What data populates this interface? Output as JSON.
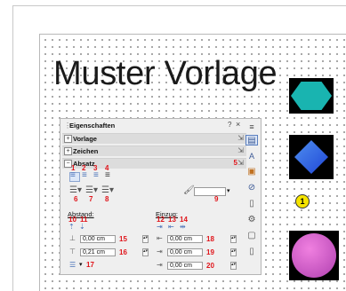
{
  "slide": {
    "title": "Muster Vorlage",
    "callout_number": "1"
  },
  "panel": {
    "title": "Eigenschaften",
    "help": "?",
    "close": "×",
    "sections": [
      {
        "label": "Vorlage"
      },
      {
        "label": "Zeichen"
      },
      {
        "label": "Absatz",
        "marker": "5"
      }
    ],
    "markers": [
      "1",
      "2",
      "3",
      "4",
      "6",
      "7",
      "8",
      "9",
      "10",
      "11",
      "12",
      "13",
      "14",
      "15",
      "16",
      "17",
      "18",
      "19",
      "20"
    ],
    "abstand_label": "Abstand:",
    "einzug_label": "Einzug:",
    "fields": {
      "space_above": "0,00 cm",
      "space_below": "0,21 cm",
      "indent_before": "0,00 cm",
      "indent_after": "0,00 cm",
      "first_line": "0,00 cm"
    }
  },
  "colors": {
    "marker_red": "#e0151b",
    "hexagon": "#19b4b0",
    "diamond": "#2f5ee0",
    "callout": "#f5e400",
    "circle": "#d060c8"
  },
  "icons": {
    "sidebar": [
      "menu-icon",
      "properties-icon",
      "styles-icon",
      "gallery-icon",
      "navigator-icon",
      "page-icon",
      "master-slides-icon",
      "animation-icon",
      "slide-transition-icon"
    ]
  }
}
